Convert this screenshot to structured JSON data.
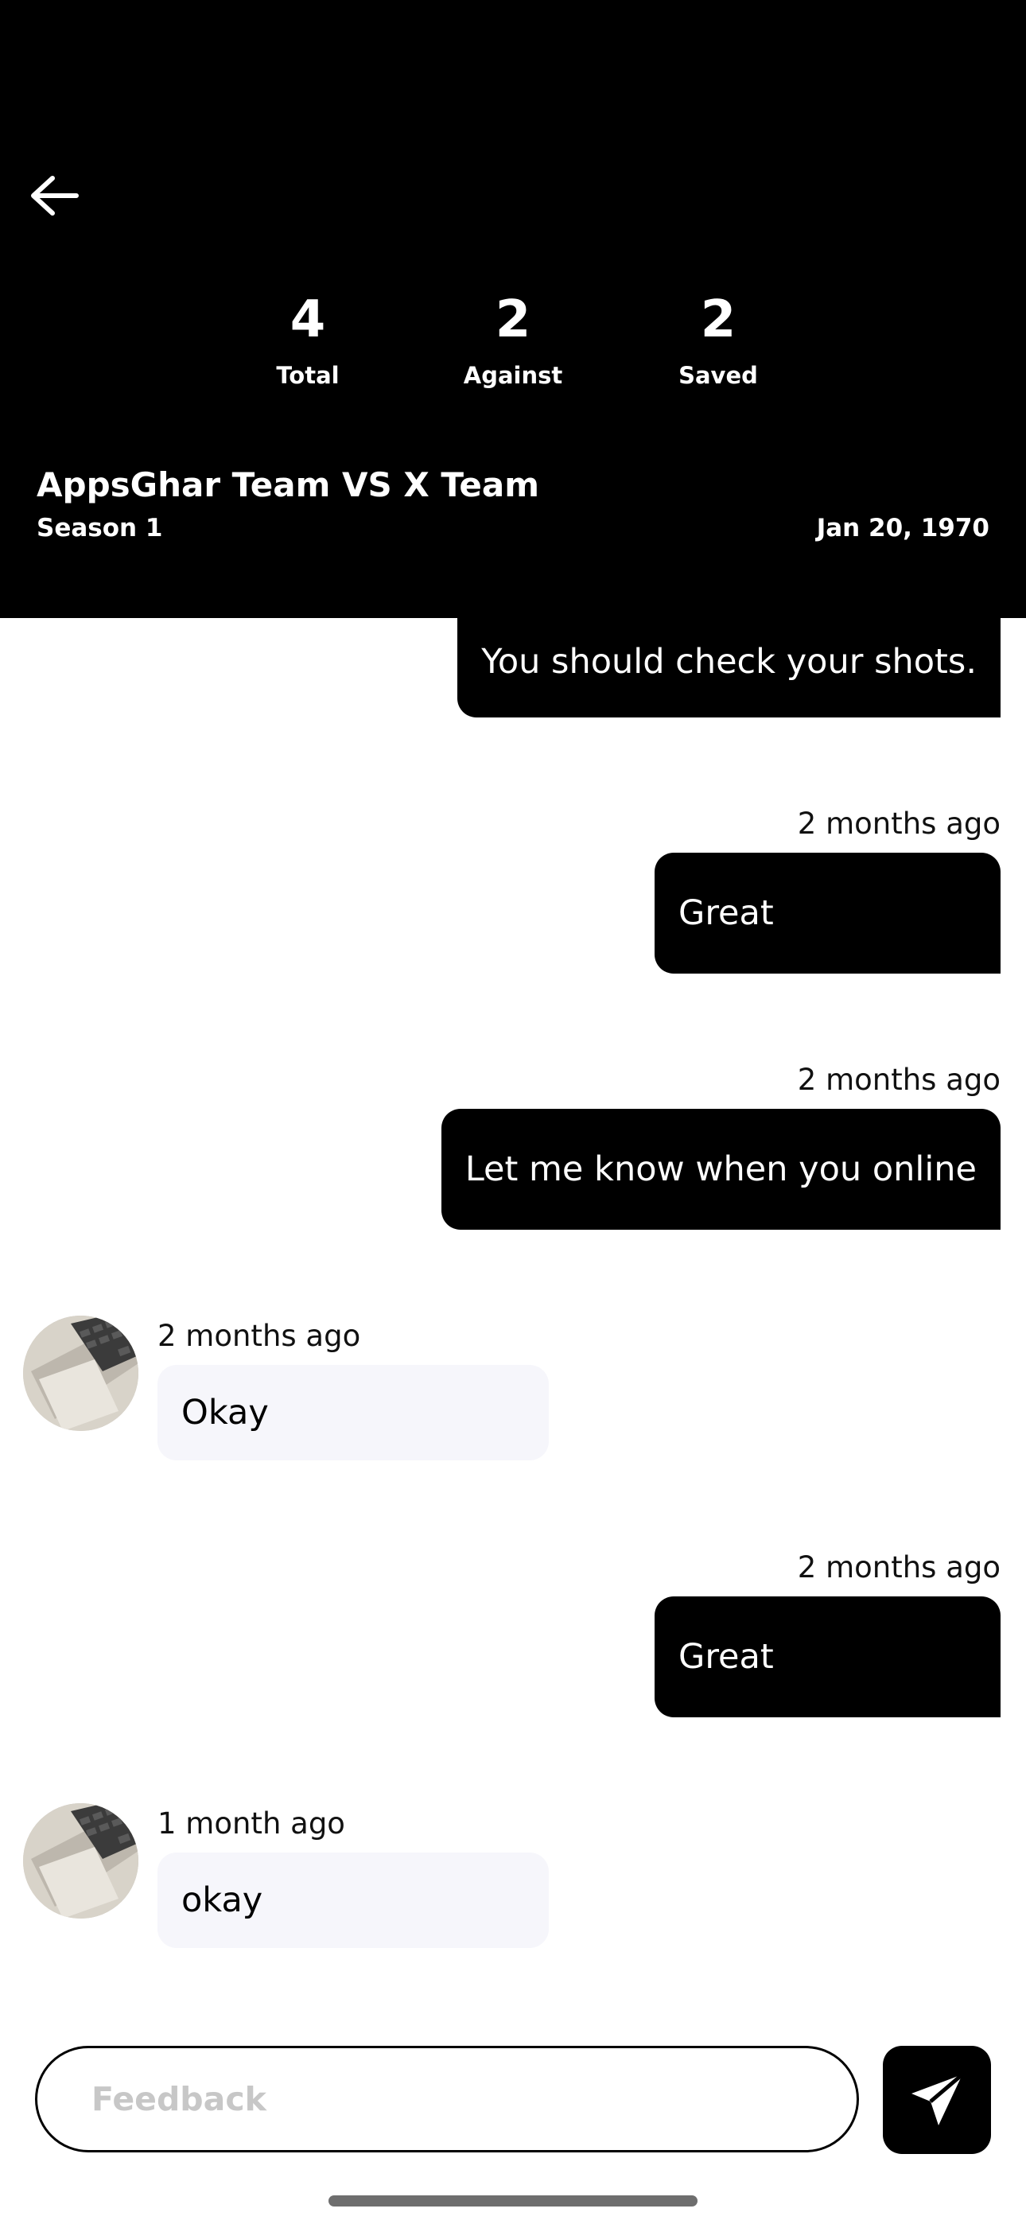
{
  "header": {
    "back_icon": "arrow-left-icon",
    "stats": [
      {
        "value": "4",
        "label": "Total"
      },
      {
        "value": "2",
        "label": "Against"
      },
      {
        "value": "2",
        "label": "Saved"
      }
    ],
    "match_title": "AppsGhar Team VS X Team",
    "season": "Season 1",
    "date": "Jan 20, 1970"
  },
  "messages": [
    {
      "direction": "sent",
      "time": "",
      "text": "You should check your shots."
    },
    {
      "direction": "sent",
      "time": "2 months ago",
      "text": "Great"
    },
    {
      "direction": "sent",
      "time": "2 months ago",
      "text": "Let me know when you online"
    },
    {
      "direction": "received",
      "time": "2 months ago",
      "text": "Okay"
    },
    {
      "direction": "sent",
      "time": "2 months ago",
      "text": "Great"
    },
    {
      "direction": "received",
      "time": "1 month ago",
      "text": "okay"
    }
  ],
  "composer": {
    "placeholder": "Feedback",
    "value": "",
    "send_icon": "send-icon"
  },
  "colors": {
    "header_bg": "#000000",
    "sent_bubble": "#000000",
    "received_bubble": "#f6f6fb",
    "placeholder": "#c7c7c7"
  }
}
